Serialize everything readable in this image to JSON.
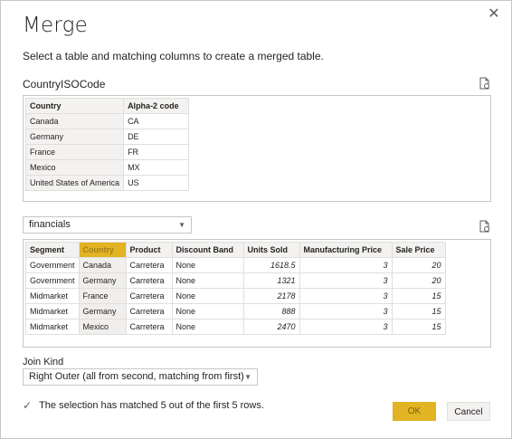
{
  "dialog": {
    "title": "Merge",
    "subtitle": "Select a table and matching columns to create a merged table.",
    "close_glyph": "✕"
  },
  "table1": {
    "name": "CountryISOCode",
    "columns": [
      "Country",
      "Alpha-2 code"
    ],
    "rows": [
      [
        "Canada",
        "CA"
      ],
      [
        "Germany",
        "DE"
      ],
      [
        "France",
        "FR"
      ],
      [
        "Mexico",
        "MX"
      ],
      [
        "United States of America",
        "US"
      ]
    ]
  },
  "table2": {
    "select_value": "financials",
    "selected_column": "Country",
    "columns": [
      "Segment",
      "Country",
      "Product",
      "Discount Band",
      "Units Sold",
      "Manufacturing Price",
      "Sale Price"
    ],
    "rows": [
      [
        "Government",
        "Canada",
        "Carretera",
        "None",
        "1618.5",
        "3",
        "20"
      ],
      [
        "Government",
        "Germany",
        "Carretera",
        "None",
        "1321",
        "3",
        "20"
      ],
      [
        "Midmarket",
        "France",
        "Carretera",
        "None",
        "2178",
        "3",
        "15"
      ],
      [
        "Midmarket",
        "Germany",
        "Carretera",
        "None",
        "888",
        "3",
        "15"
      ],
      [
        "Midmarket",
        "Mexico",
        "Carretera",
        "None",
        "2470",
        "3",
        "15"
      ]
    ]
  },
  "join": {
    "label": "Join Kind",
    "value": "Right Outer (all from second, matching from first)"
  },
  "status": {
    "text": "The selection has matched 5 out of the first 5 rows.",
    "icon": "checkmark-icon"
  },
  "buttons": {
    "ok": "OK",
    "cancel": "Cancel"
  },
  "colors": {
    "accent": "#e2b322",
    "header_bg": "#f3f2f1",
    "border": "#c8c6c4"
  }
}
